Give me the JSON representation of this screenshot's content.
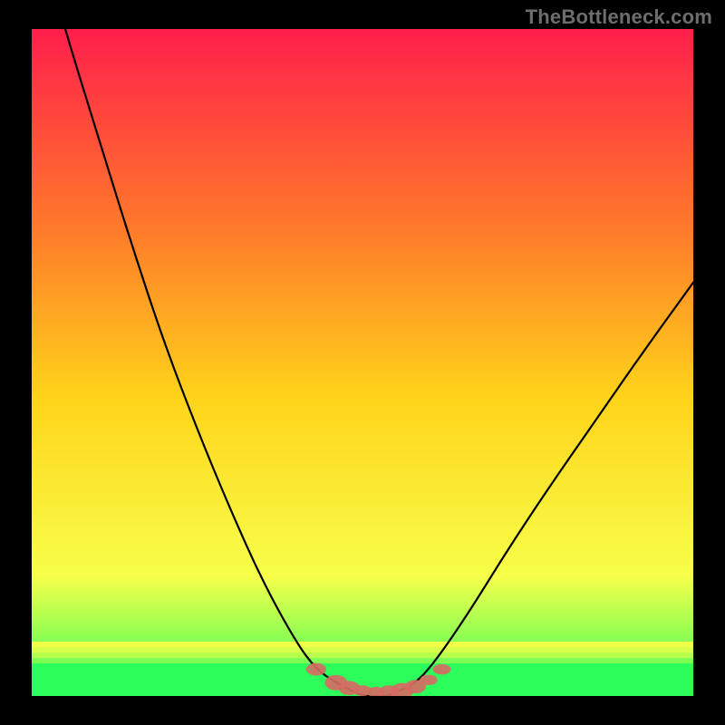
{
  "watermark": "TheBottleneck.com",
  "colors": {
    "frame": "#000000",
    "gradient_top": "#ff1f4b",
    "gradient_mid_upper": "#ff7a2a",
    "gradient_mid": "#ffd31a",
    "gradient_lower": "#f7ff4a",
    "gradient_bottom": "#2cff5c",
    "curve": "#000000",
    "marker": "#d66b63"
  },
  "chart_data": {
    "type": "line",
    "title": "",
    "xlabel": "",
    "ylabel": "",
    "xlim": [
      0,
      100
    ],
    "ylim": [
      0,
      100
    ],
    "x": [
      0,
      5,
      10,
      15,
      20,
      25,
      30,
      35,
      40,
      43,
      46,
      48,
      50,
      52,
      54,
      56,
      58,
      60,
      63,
      67,
      72,
      78,
      85,
      92,
      100
    ],
    "values": [
      118,
      100,
      84,
      68,
      53,
      40,
      28,
      17,
      8,
      4,
      2,
      1,
      0,
      0,
      0,
      1,
      2,
      4,
      8,
      14,
      22,
      31,
      41,
      51,
      62
    ],
    "markers_x": [
      43,
      46,
      48,
      50,
      52,
      54,
      56,
      58,
      60,
      62
    ],
    "markers_y": [
      4,
      2,
      1.2,
      0.8,
      0.6,
      0.6,
      0.8,
      1.4,
      2.4,
      4
    ],
    "annotations": []
  }
}
